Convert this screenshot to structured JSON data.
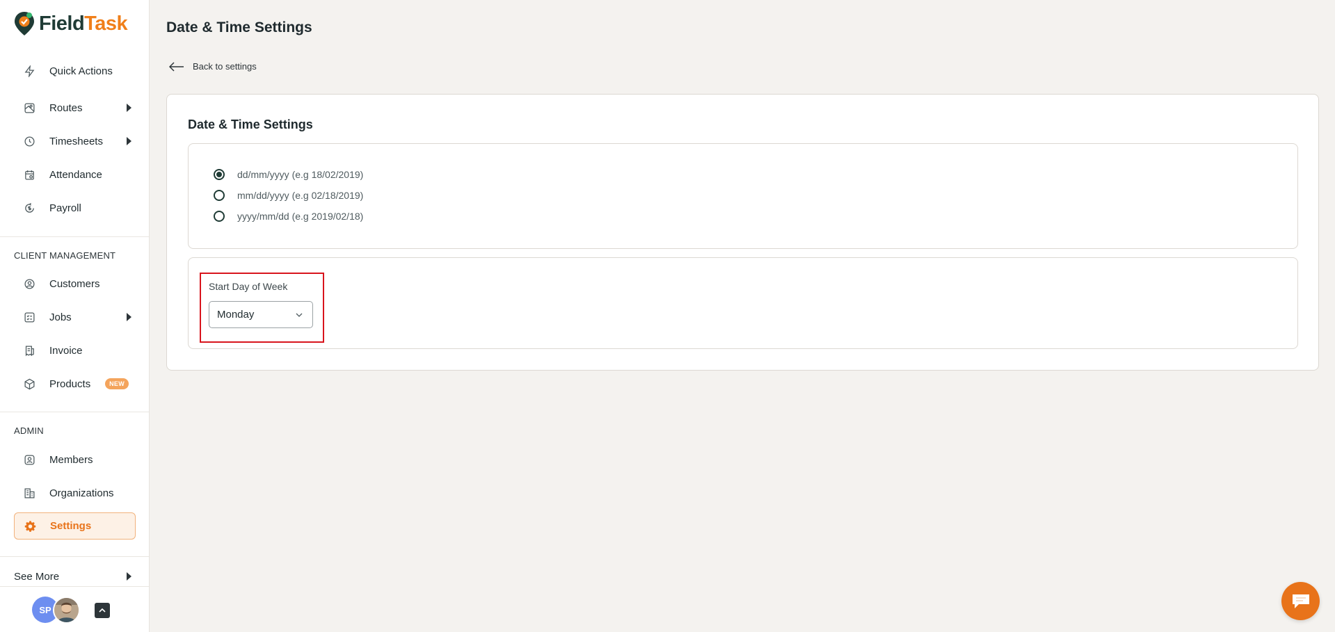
{
  "brand": {
    "name_part1": "Field",
    "name_part2": "Task",
    "logo_icon": "map-pin-logo",
    "accent": "#f07f1a",
    "dark": "#1f3b35"
  },
  "sidebar": {
    "items": [
      {
        "label": "Quick Actions",
        "icon": "lightning-icon"
      },
      {
        "label": "Routes",
        "icon": "map-icon",
        "has_submenu": true
      },
      {
        "label": "Timesheets",
        "icon": "clock-icon",
        "has_submenu": true
      },
      {
        "label": "Attendance",
        "icon": "calendar-check-icon"
      },
      {
        "label": "Payroll",
        "icon": "dollar-cycle-icon"
      }
    ],
    "client_heading": "CLIENT MANAGEMENT",
    "client_items": [
      {
        "label": "Customers",
        "icon": "user-circle-icon"
      },
      {
        "label": "Jobs",
        "icon": "checklist-icon",
        "has_submenu": true
      },
      {
        "label": "Invoice",
        "icon": "receipt-icon"
      },
      {
        "label": "Products",
        "icon": "box-icon",
        "badge": "NEW"
      }
    ],
    "admin_heading": "ADMIN",
    "admin_items": [
      {
        "label": "Members",
        "icon": "user-square-icon"
      },
      {
        "label": "Organizations",
        "icon": "building-icon"
      },
      {
        "label": "Settings",
        "icon": "gear-icon",
        "active": true
      }
    ],
    "see_more": "See More",
    "user": {
      "initials": "SP"
    }
  },
  "page": {
    "title": "Date & Time Settings",
    "back_label": "Back to settings",
    "card_title": "Date & Time Settings",
    "date_formats": [
      {
        "label": "dd/mm/yyyy (e.g 18/02/2019)",
        "selected": true
      },
      {
        "label": "mm/dd/yyyy (e.g 02/18/2019)",
        "selected": false
      },
      {
        "label": "yyyy/mm/dd (e.g 2019/02/18)",
        "selected": false
      }
    ],
    "start_day": {
      "label": "Start Day of Week",
      "value": "Monday"
    }
  }
}
